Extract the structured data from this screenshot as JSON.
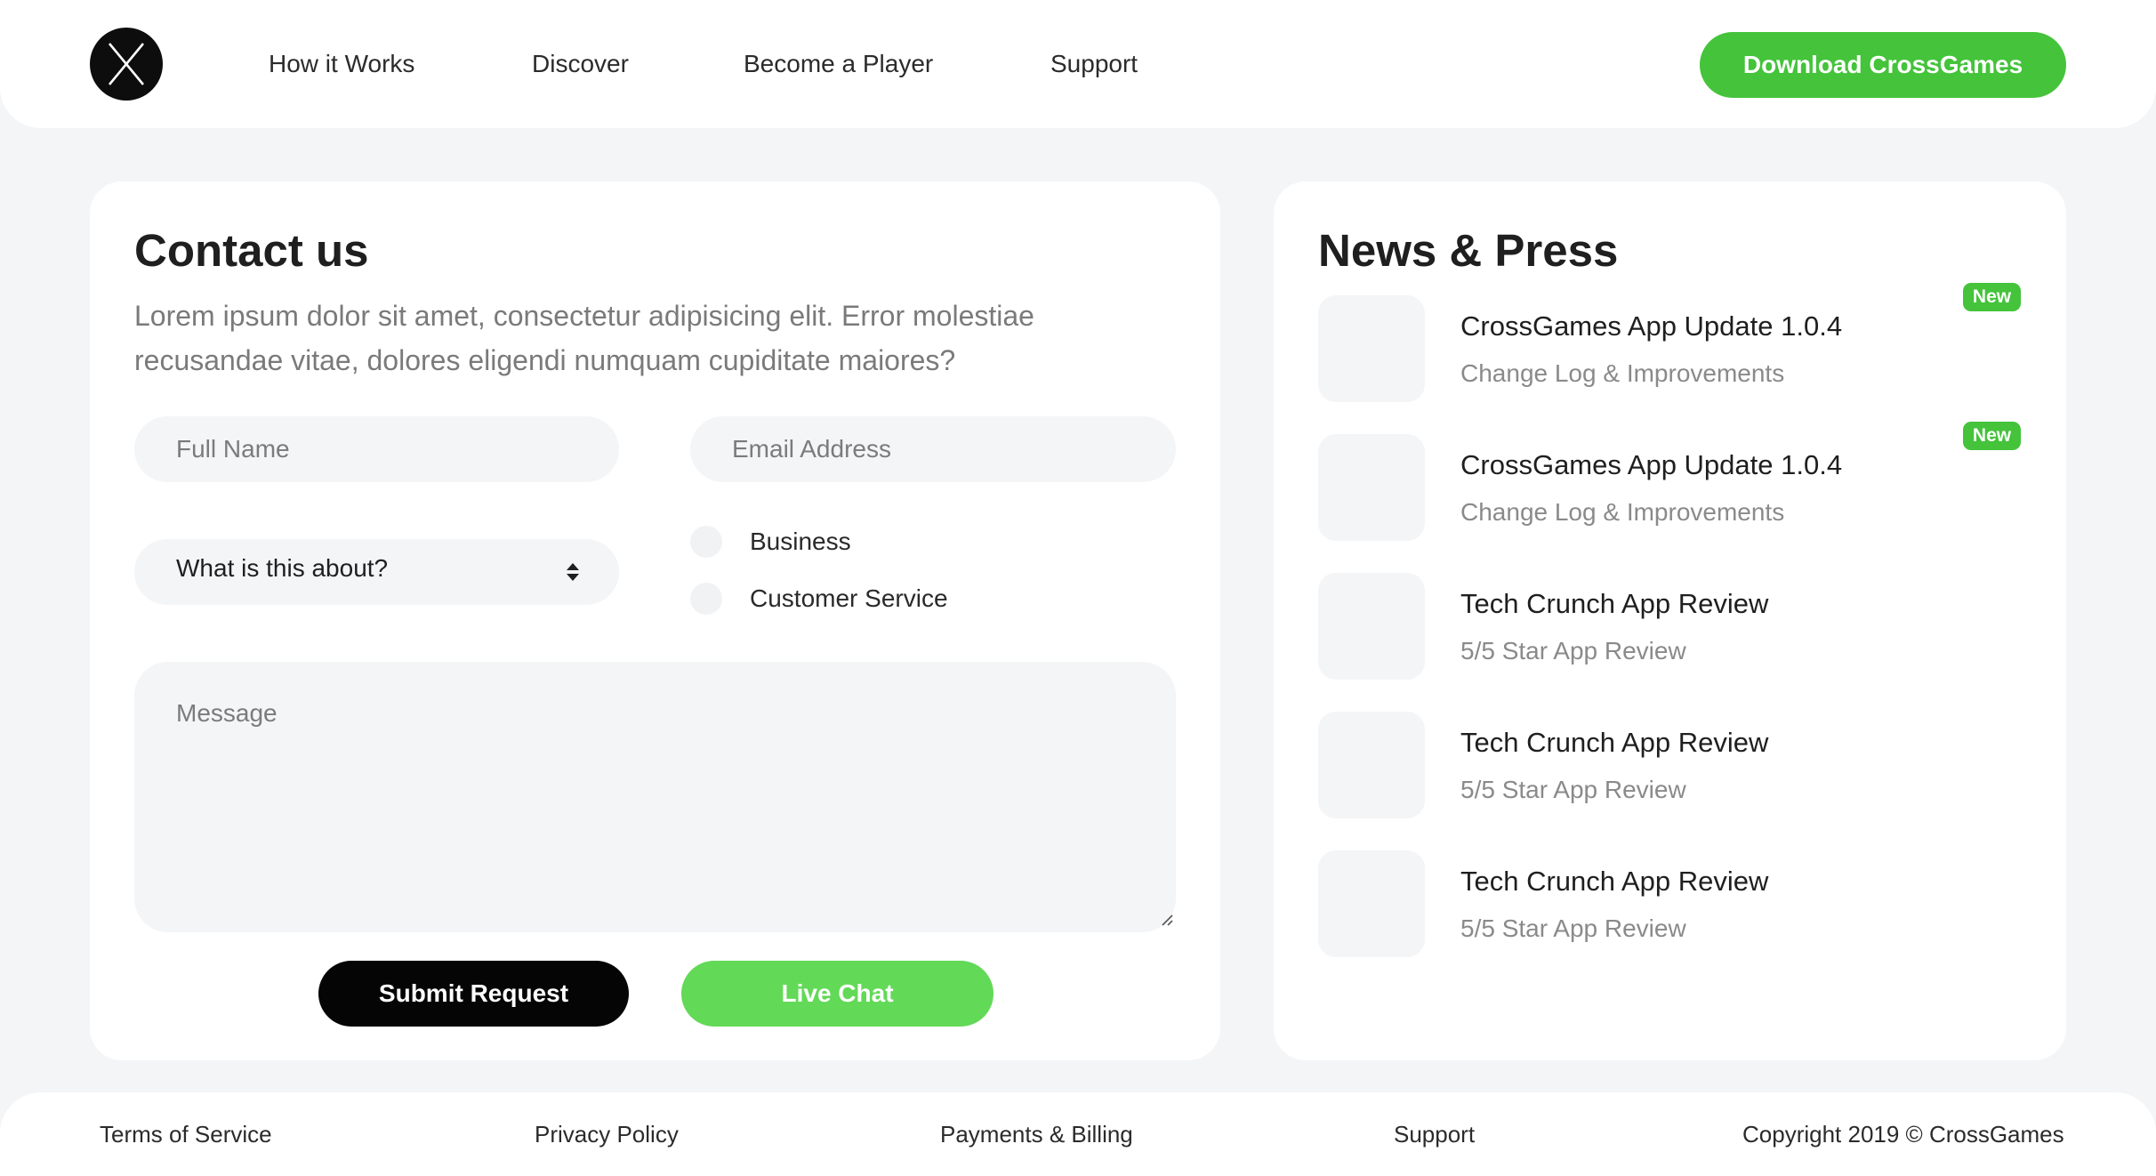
{
  "header": {
    "logo_icon": "crossgames-x-logo",
    "nav": [
      {
        "label": "How it Works"
      },
      {
        "label": "Discover"
      },
      {
        "label": "Become a Player"
      },
      {
        "label": "Support"
      }
    ],
    "cta_label": "Download CrossGames"
  },
  "contact": {
    "title": "Contact us",
    "intro": "Lorem ipsum dolor sit amet, consectetur adipisicing elit. Error molestiae recusandae vitae, dolores eligendi numquam cupiditate maiores?",
    "full_name": {
      "placeholder": "Full Name",
      "value": ""
    },
    "email": {
      "placeholder": "Email Address",
      "value": ""
    },
    "topic": {
      "selected": "What is this about?"
    },
    "radios": [
      {
        "label": "Business",
        "checked": false
      },
      {
        "label": "Customer Service",
        "checked": false
      }
    ],
    "message": {
      "placeholder": "Message",
      "value": ""
    },
    "submit_label": "Submit Request",
    "chat_label": "Live Chat"
  },
  "news": {
    "title": "News & Press",
    "items": [
      {
        "title": "CrossGames App Update 1.0.4",
        "subtitle": "Change Log & Improvements",
        "badge": "New"
      },
      {
        "title": "CrossGames App Update 1.0.4",
        "subtitle": "Change Log & Improvements",
        "badge": "New"
      },
      {
        "title": "Tech Crunch App Review",
        "subtitle": "5/5 Star App Review",
        "badge": ""
      },
      {
        "title": "Tech Crunch App Review",
        "subtitle": "5/5 Star App Review",
        "badge": ""
      },
      {
        "title": "Tech Crunch App Review",
        "subtitle": "5/5 Star App Review",
        "badge": ""
      }
    ]
  },
  "footer": {
    "links": [
      {
        "label": "Terms of Service"
      },
      {
        "label": "Privacy Policy"
      },
      {
        "label": "Payments & Billing"
      },
      {
        "label": "Support"
      }
    ],
    "copyright": "Copyright 2019 © CrossGames"
  },
  "colors": {
    "accent_green": "#44c33b",
    "live_chat_green": "#62d957",
    "page_background": "#f4f5f7",
    "dark": "#050505"
  }
}
